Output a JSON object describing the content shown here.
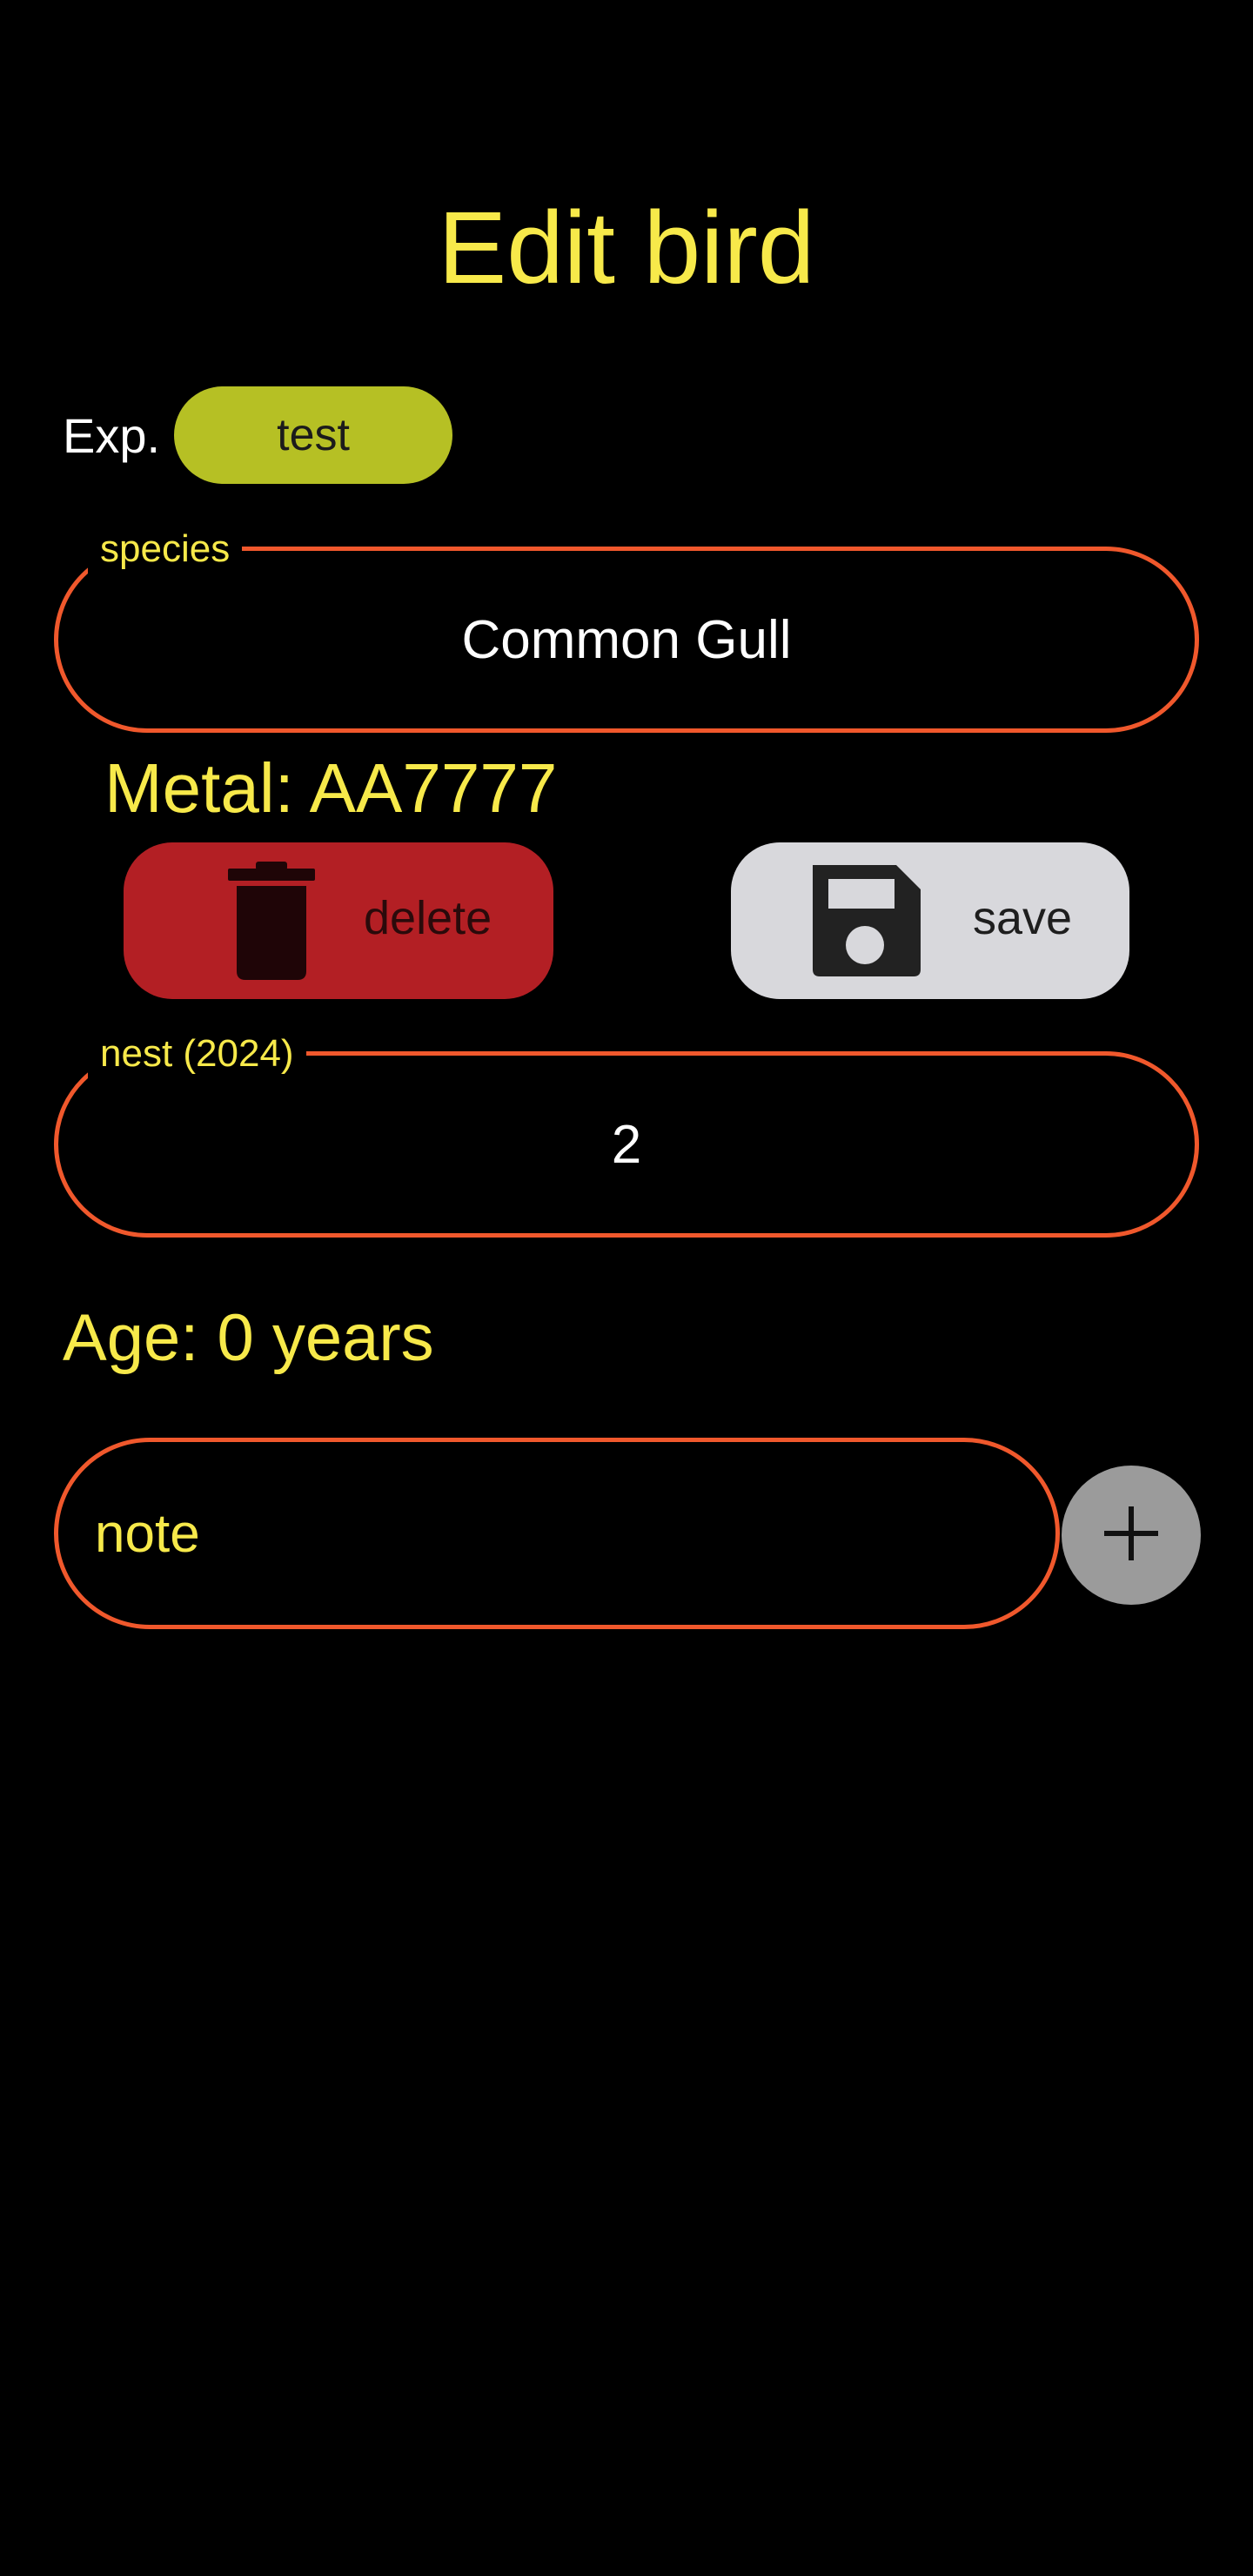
{
  "header": {
    "title": "Edit bird"
  },
  "experiment": {
    "label": "Exp.",
    "chip_label": "test",
    "chip_color": "#b6c024"
  },
  "species_field": {
    "legend": "species",
    "value": "Common Gull"
  },
  "metal": {
    "text": "Metal: AA7777"
  },
  "actions": {
    "delete_label": "delete",
    "delete_icon": "trash-icon",
    "save_label": "save",
    "save_icon": "floppy-disk-icon"
  },
  "nest_field": {
    "legend": "nest (2024)",
    "value": "2"
  },
  "age": {
    "text": "Age: 0 years"
  },
  "note": {
    "placeholder": "note",
    "add_icon": "plus-icon"
  },
  "colors": {
    "background": "#000000",
    "accent_yellow": "#f7e94a",
    "outline_orange": "#f0582c",
    "delete_red": "#b31f24",
    "save_grey": "#d8d8dc",
    "add_grey": "#9b9b9b"
  }
}
